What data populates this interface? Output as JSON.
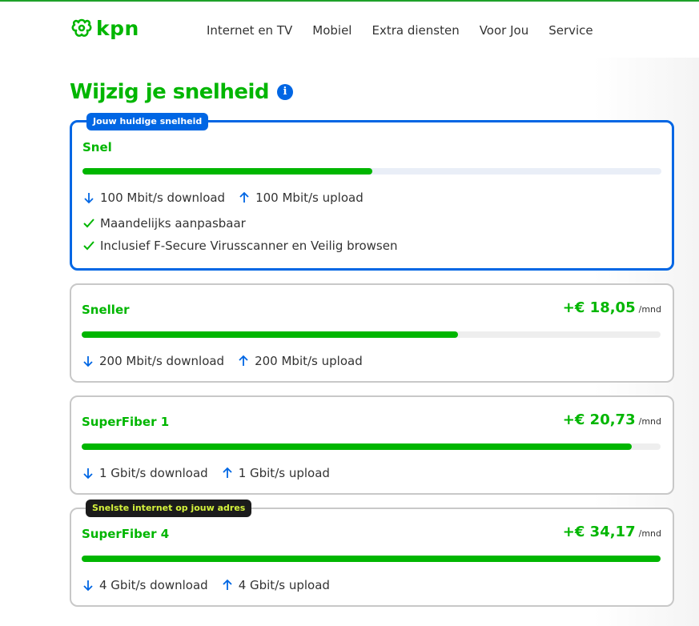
{
  "header": {
    "logo_text": "kpn",
    "nav": [
      "Internet en TV",
      "Mobiel",
      "Extra diensten",
      "Voor Jou",
      "Service"
    ]
  },
  "page": {
    "title": "Wijzig je snelheid",
    "info_glyph": "i"
  },
  "plans": [
    {
      "badge": "Jouw huidige snelheid",
      "name": "Snel",
      "speed_fraction": 0.5,
      "download": "100 Mbit/s download",
      "upload": "100 Mbit/s upload",
      "features": [
        "Maandelijks aanpasbaar",
        "Inclusief F-Secure Virusscanner en Veilig browsen"
      ]
    },
    {
      "name": "Sneller",
      "price": "+€ 18,05",
      "price_unit": "/mnd",
      "speed_fraction": 0.65,
      "download": "200 Mbit/s download",
      "upload": "200 Mbit/s upload"
    },
    {
      "name": "SuperFiber 1",
      "price": "+€ 20,73",
      "price_unit": "/mnd",
      "speed_fraction": 0.95,
      "download": "1 Gbit/s download",
      "upload": "1 Gbit/s upload"
    },
    {
      "badge": "Snelste internet op jouw adres",
      "name": "SuperFiber 4",
      "price": "+€ 34,17",
      "price_unit": "/mnd",
      "speed_fraction": 1.0,
      "download": "4 Gbit/s download",
      "upload": "4 Gbit/s upload"
    }
  ],
  "colors": {
    "brand_green": "#00b600",
    "accent_blue": "#0066e4",
    "badge_dark": "#1b1b1b",
    "badge_lime": "#d4f23c"
  }
}
